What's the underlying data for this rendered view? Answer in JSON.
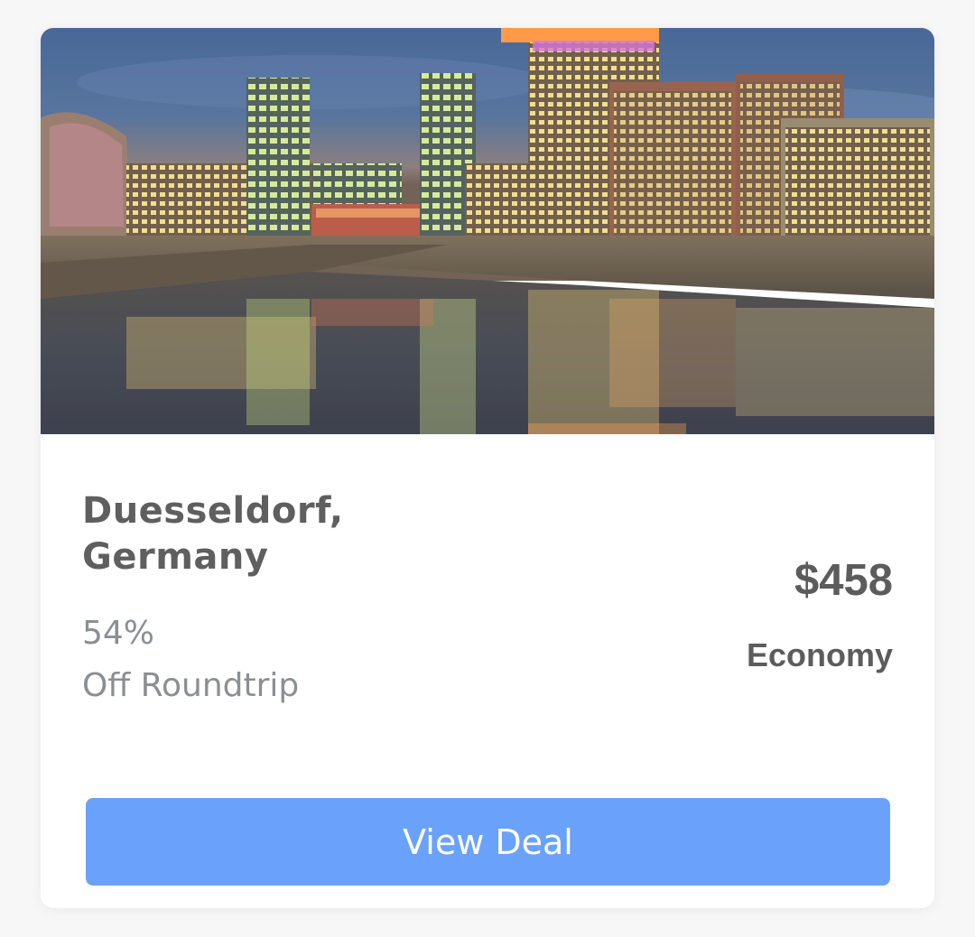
{
  "deal": {
    "destination_line1": "Duesseldorf,",
    "destination_line2": "Germany",
    "discount_percent": "54%",
    "discount_label": "Off Roundtrip",
    "price": "$458",
    "cabin_class": "Economy",
    "cta_label": "View Deal"
  },
  "colors": {
    "button": "#6aa2fb",
    "title_text": "#5f5f5f",
    "muted_text": "#8b8f94",
    "card_bg": "#ffffff",
    "page_bg": "#f7f7f8"
  },
  "image": {
    "subject": "city-skyline-night-harbor-photo"
  }
}
